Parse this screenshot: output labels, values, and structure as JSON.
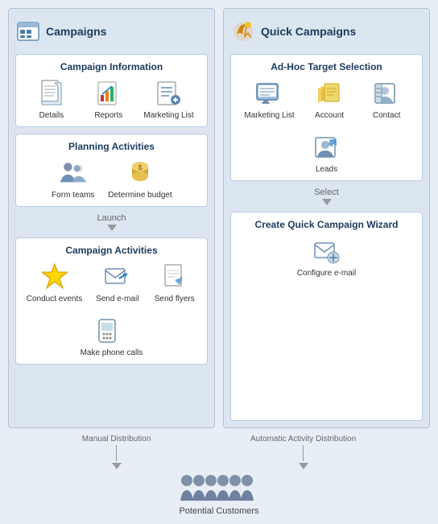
{
  "leftPanel": {
    "title": "Campaigns",
    "campaignInfo": {
      "title": "Campaign Information",
      "items": [
        {
          "label": "Details",
          "icon": "details"
        },
        {
          "label": "Reports",
          "icon": "reports"
        },
        {
          "label": "Marketing List",
          "icon": "marketing-list"
        }
      ]
    },
    "planningActivities": {
      "title": "Planning Activities",
      "items": [
        {
          "label": "Form teams",
          "icon": "form-teams"
        },
        {
          "label": "Determine budget",
          "icon": "determine-budget"
        }
      ]
    },
    "launchLabel": "Launch",
    "campaignActivities": {
      "title": "Campaign Activities",
      "items": [
        {
          "label": "Conduct events",
          "icon": "conduct-events"
        },
        {
          "label": "Send e-mail",
          "icon": "send-email"
        },
        {
          "label": "Send flyers",
          "icon": "send-flyers"
        },
        {
          "label": "Make phone calls",
          "icon": "make-phone-calls"
        }
      ]
    }
  },
  "rightPanel": {
    "title": "Quick Campaigns",
    "adHocTarget": {
      "title": "Ad-Hoc Target Selection",
      "items": [
        {
          "label": "Marketing List",
          "icon": "marketing-list"
        },
        {
          "label": "Account",
          "icon": "account"
        },
        {
          "label": "Contact",
          "icon": "contact"
        },
        {
          "label": "Leads",
          "icon": "leads"
        }
      ]
    },
    "selectLabel": "Select",
    "createWizard": {
      "title": "Create Quick Campaign Wizard",
      "items": [
        {
          "label": "Configure e-mail",
          "icon": "configure-email"
        }
      ]
    }
  },
  "bottom": {
    "leftArrowLabel": "Manual Distribution",
    "rightArrowLabel": "Automatic Activity Distribution",
    "customersLabel": "Potential Customers"
  }
}
